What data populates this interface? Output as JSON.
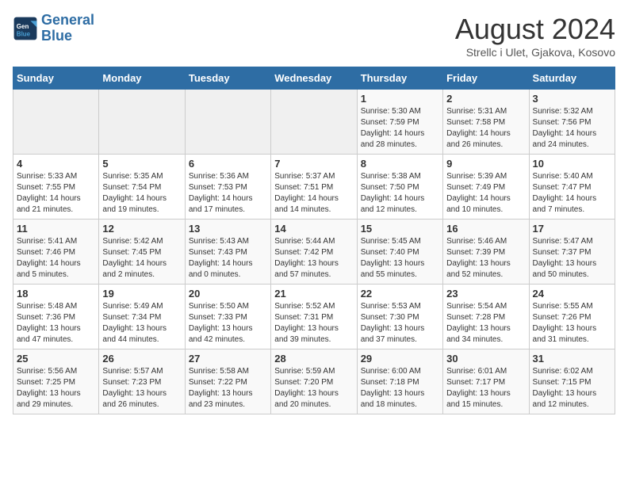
{
  "header": {
    "logo_line1": "General",
    "logo_line2": "Blue",
    "month_title": "August 2024",
    "location": "Strellc i Ulet, Gjakova, Kosovo"
  },
  "days_of_week": [
    "Sunday",
    "Monday",
    "Tuesday",
    "Wednesday",
    "Thursday",
    "Friday",
    "Saturday"
  ],
  "weeks": [
    [
      {
        "day": "",
        "info": ""
      },
      {
        "day": "",
        "info": ""
      },
      {
        "day": "",
        "info": ""
      },
      {
        "day": "",
        "info": ""
      },
      {
        "day": "1",
        "info": "Sunrise: 5:30 AM\nSunset: 7:59 PM\nDaylight: 14 hours\nand 28 minutes."
      },
      {
        "day": "2",
        "info": "Sunrise: 5:31 AM\nSunset: 7:58 PM\nDaylight: 14 hours\nand 26 minutes."
      },
      {
        "day": "3",
        "info": "Sunrise: 5:32 AM\nSunset: 7:56 PM\nDaylight: 14 hours\nand 24 minutes."
      }
    ],
    [
      {
        "day": "4",
        "info": "Sunrise: 5:33 AM\nSunset: 7:55 PM\nDaylight: 14 hours\nand 21 minutes."
      },
      {
        "day": "5",
        "info": "Sunrise: 5:35 AM\nSunset: 7:54 PM\nDaylight: 14 hours\nand 19 minutes."
      },
      {
        "day": "6",
        "info": "Sunrise: 5:36 AM\nSunset: 7:53 PM\nDaylight: 14 hours\nand 17 minutes."
      },
      {
        "day": "7",
        "info": "Sunrise: 5:37 AM\nSunset: 7:51 PM\nDaylight: 14 hours\nand 14 minutes."
      },
      {
        "day": "8",
        "info": "Sunrise: 5:38 AM\nSunset: 7:50 PM\nDaylight: 14 hours\nand 12 minutes."
      },
      {
        "day": "9",
        "info": "Sunrise: 5:39 AM\nSunset: 7:49 PM\nDaylight: 14 hours\nand 10 minutes."
      },
      {
        "day": "10",
        "info": "Sunrise: 5:40 AM\nSunset: 7:47 PM\nDaylight: 14 hours\nand 7 minutes."
      }
    ],
    [
      {
        "day": "11",
        "info": "Sunrise: 5:41 AM\nSunset: 7:46 PM\nDaylight: 14 hours\nand 5 minutes."
      },
      {
        "day": "12",
        "info": "Sunrise: 5:42 AM\nSunset: 7:45 PM\nDaylight: 14 hours\nand 2 minutes."
      },
      {
        "day": "13",
        "info": "Sunrise: 5:43 AM\nSunset: 7:43 PM\nDaylight: 14 hours\nand 0 minutes."
      },
      {
        "day": "14",
        "info": "Sunrise: 5:44 AM\nSunset: 7:42 PM\nDaylight: 13 hours\nand 57 minutes."
      },
      {
        "day": "15",
        "info": "Sunrise: 5:45 AM\nSunset: 7:40 PM\nDaylight: 13 hours\nand 55 minutes."
      },
      {
        "day": "16",
        "info": "Sunrise: 5:46 AM\nSunset: 7:39 PM\nDaylight: 13 hours\nand 52 minutes."
      },
      {
        "day": "17",
        "info": "Sunrise: 5:47 AM\nSunset: 7:37 PM\nDaylight: 13 hours\nand 50 minutes."
      }
    ],
    [
      {
        "day": "18",
        "info": "Sunrise: 5:48 AM\nSunset: 7:36 PM\nDaylight: 13 hours\nand 47 minutes."
      },
      {
        "day": "19",
        "info": "Sunrise: 5:49 AM\nSunset: 7:34 PM\nDaylight: 13 hours\nand 44 minutes."
      },
      {
        "day": "20",
        "info": "Sunrise: 5:50 AM\nSunset: 7:33 PM\nDaylight: 13 hours\nand 42 minutes."
      },
      {
        "day": "21",
        "info": "Sunrise: 5:52 AM\nSunset: 7:31 PM\nDaylight: 13 hours\nand 39 minutes."
      },
      {
        "day": "22",
        "info": "Sunrise: 5:53 AM\nSunset: 7:30 PM\nDaylight: 13 hours\nand 37 minutes."
      },
      {
        "day": "23",
        "info": "Sunrise: 5:54 AM\nSunset: 7:28 PM\nDaylight: 13 hours\nand 34 minutes."
      },
      {
        "day": "24",
        "info": "Sunrise: 5:55 AM\nSunset: 7:26 PM\nDaylight: 13 hours\nand 31 minutes."
      }
    ],
    [
      {
        "day": "25",
        "info": "Sunrise: 5:56 AM\nSunset: 7:25 PM\nDaylight: 13 hours\nand 29 minutes."
      },
      {
        "day": "26",
        "info": "Sunrise: 5:57 AM\nSunset: 7:23 PM\nDaylight: 13 hours\nand 26 minutes."
      },
      {
        "day": "27",
        "info": "Sunrise: 5:58 AM\nSunset: 7:22 PM\nDaylight: 13 hours\nand 23 minutes."
      },
      {
        "day": "28",
        "info": "Sunrise: 5:59 AM\nSunset: 7:20 PM\nDaylight: 13 hours\nand 20 minutes."
      },
      {
        "day": "29",
        "info": "Sunrise: 6:00 AM\nSunset: 7:18 PM\nDaylight: 13 hours\nand 18 minutes."
      },
      {
        "day": "30",
        "info": "Sunrise: 6:01 AM\nSunset: 7:17 PM\nDaylight: 13 hours\nand 15 minutes."
      },
      {
        "day": "31",
        "info": "Sunrise: 6:02 AM\nSunset: 7:15 PM\nDaylight: 13 hours\nand 12 minutes."
      }
    ]
  ]
}
